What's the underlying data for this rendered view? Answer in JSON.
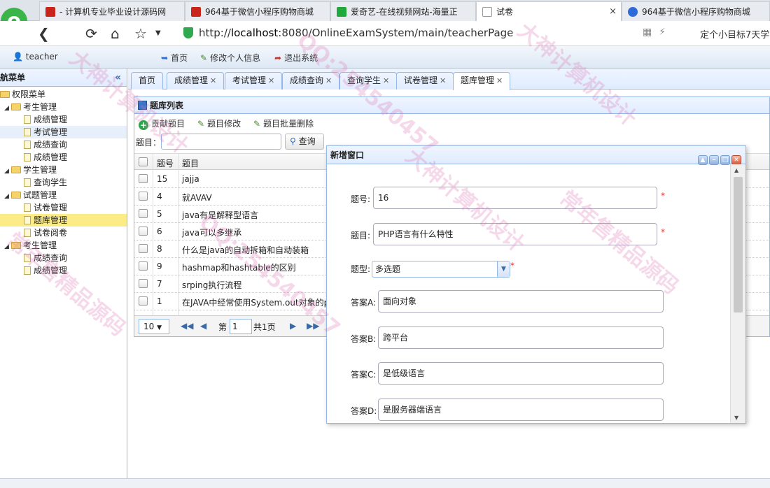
{
  "browser": {
    "tabs": [
      {
        "title": "- 计算机专业毕业设计源码网",
        "active": false
      },
      {
        "title": "964基于微信小程序购物商城",
        "active": false
      },
      {
        "title": "爱奇艺-在线视频网站-海量正",
        "active": false
      },
      {
        "title": "试卷",
        "active": true,
        "close": "×"
      },
      {
        "title": "964基于微信小程序购物商城",
        "active": false
      }
    ],
    "url_prefix": "http://",
    "url_host": "localhost",
    "url_rest": ":8080/OnlineExamSystem/main/teacherPage",
    "right_text": "定个小目标7天学"
  },
  "header": {
    "user": "teacher",
    "links": [
      "首页",
      "修改个人信息",
      "退出系统"
    ]
  },
  "sidebar": {
    "title": "航菜单",
    "collapse": "«",
    "root": "权限菜单",
    "groups": [
      {
        "label": "考生管理",
        "items": [
          "成绩管理",
          "考试管理",
          "成绩查询",
          "成绩管理"
        ]
      },
      {
        "label": "学生管理",
        "items": [
          "查询学生"
        ]
      },
      {
        "label": "试题管理",
        "items": [
          "试卷管理",
          "题库管理",
          "试卷阅卷"
        ]
      },
      {
        "label": "考生管理",
        "items": [
          "成绩查询",
          "成绩管理"
        ]
      }
    ]
  },
  "main_tabs": [
    {
      "label": "首页",
      "closable": false
    },
    {
      "label": "成绩管理",
      "closable": true
    },
    {
      "label": "考试管理",
      "closable": true
    },
    {
      "label": "成绩查询",
      "closable": true
    },
    {
      "label": "查询学生",
      "closable": true
    },
    {
      "label": "试卷管理",
      "closable": true
    },
    {
      "label": "题库管理",
      "closable": true,
      "active": true
    }
  ],
  "grid": {
    "title": "题库列表",
    "toolbar": [
      "贡献题目",
      "题目修改",
      "题目批量删除"
    ],
    "search_label": "题目：",
    "search_button": "查询",
    "columns": [
      "题号",
      "题目"
    ],
    "rows": [
      {
        "id": "15",
        "title": "jajja"
      },
      {
        "id": "4",
        "title": "就AVAV"
      },
      {
        "id": "5",
        "title": "java有是解释型语言"
      },
      {
        "id": "6",
        "title": "java可以多继承"
      },
      {
        "id": "8",
        "title": "什么是java的自动拆箱和自动装箱"
      },
      {
        "id": "9",
        "title": "hashmap和hashtable的区别"
      },
      {
        "id": "7",
        "title": "srping执行流程"
      },
      {
        "id": "1",
        "title": "在JAVA中经常使用System.out对象的p"
      }
    ],
    "pager": {
      "page_size": "10",
      "page_label": "第",
      "page_num": "1",
      "total": "共1页"
    }
  },
  "dialog": {
    "title": "新增窗口",
    "fields": [
      {
        "label": "题号:",
        "value": "16",
        "required": "*"
      },
      {
        "label": "题目:",
        "value": "PHP语言有什么特性",
        "required": "*"
      },
      {
        "label": "题型:",
        "value": "多选题",
        "required": "*"
      },
      {
        "label": "答案A:",
        "value": "面向对象"
      },
      {
        "label": "答案B:",
        "value": "跨平台"
      },
      {
        "label": "答案C:",
        "value": "是低级语言"
      },
      {
        "label": "答案D:",
        "value": "是服务器端语言"
      }
    ]
  },
  "watermarks": [
    "大神计算机设计",
    "常年售精品源码",
    "QQ:254540457"
  ]
}
